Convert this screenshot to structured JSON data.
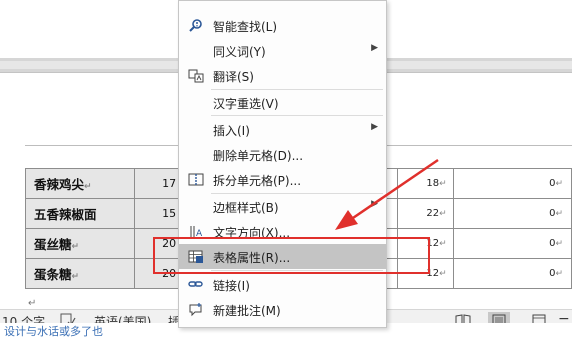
{
  "menu": {
    "items": [
      {
        "label": "智能查找(L)",
        "icon": "smart-lookup-icon",
        "submenu": false
      },
      {
        "label": "同义词(Y)",
        "icon": "",
        "submenu": true
      },
      {
        "label": "翻译(S)",
        "icon": "translate-icon",
        "submenu": false
      },
      {
        "label": "汉字重选(V)",
        "icon": "",
        "submenu": false
      },
      {
        "label": "插入(I)",
        "icon": "",
        "submenu": true
      },
      {
        "label": "删除单元格(D)...",
        "icon": "",
        "submenu": false
      },
      {
        "label": "拆分单元格(P)...",
        "icon": "split-cells-icon",
        "submenu": false
      },
      {
        "label": "边框样式(B)",
        "icon": "",
        "submenu": true
      },
      {
        "label": "文字方向(X)...",
        "icon": "text-direction-icon",
        "submenu": false
      },
      {
        "label": "表格属性(R)...",
        "icon": "table-properties-icon",
        "submenu": false,
        "highlighted": true
      },
      {
        "label": "链接(I)",
        "icon": "link-icon",
        "submenu": false
      },
      {
        "label": "新建批注(M)",
        "icon": "new-comment-icon",
        "submenu": false
      }
    ]
  },
  "table": {
    "rows": [
      {
        "name": "香辣鸡尖",
        "num": "17",
        "v1": "18",
        "v2": "0"
      },
      {
        "name": "五香辣椒面",
        "num": "15",
        "v1": "22",
        "v2": "0"
      },
      {
        "name": "蛋丝糖",
        "num": "20",
        "v1": "12",
        "v2": "0"
      },
      {
        "name": "蛋条糖",
        "num": "20",
        "v1": "12",
        "v2": "0"
      }
    ],
    "cell_mark": "↵"
  },
  "statusbar": {
    "word_count": "10 个字",
    "language": "英语(美国)",
    "insert": "插..."
  },
  "bottom_text": "设计与水话或多了也",
  "colors": {
    "highlight": "#c4c4c4",
    "annotation": "#e0302c",
    "ruler": "#d6d6d6"
  }
}
